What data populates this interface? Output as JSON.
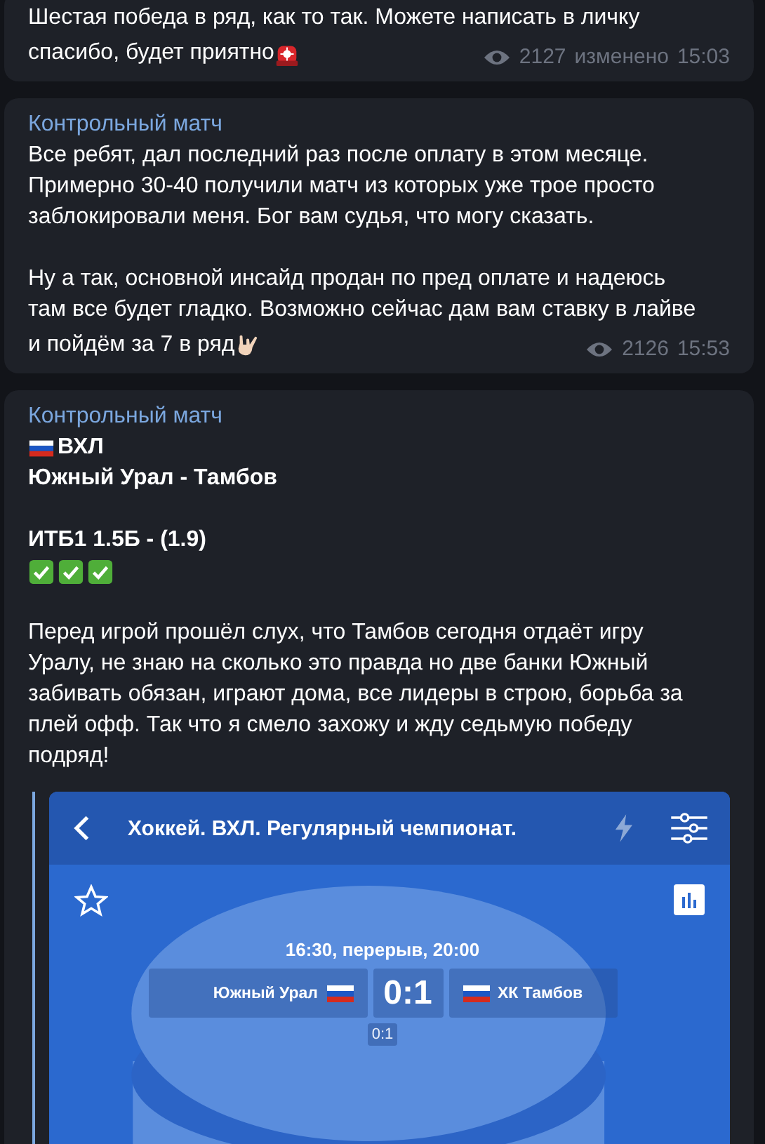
{
  "messages": [
    {
      "blocks": [
        {
          "kind": "text",
          "bold": false,
          "lines": [
            "Шестая победа в ряд, как то так. Можете написать в личку",
            "спасибо, будет приятно"
          ],
          "trail_icon": {
            "kind": "siren"
          }
        }
      ],
      "views": "2127",
      "edited": "изменено",
      "time": "15:03"
    },
    {
      "author": "Контрольный матч",
      "blocks": [
        {
          "kind": "text",
          "bold": false,
          "lines": [
            "Все ребят, дал последний раз после оплату в этом месяце.",
            "Примерно 30-40 получили матч из которых уже трое просто",
            "заблокировали меня. Бог вам судья, что могу сказать."
          ]
        },
        {
          "kind": "text",
          "bold": false,
          "lines": [
            "Ну а так, основной инсайд продан по пред оплате и надеюсь",
            "там все будет гладко. Возможно сейчас дам вам ставку в лайве",
            "и пойдём за 7 в ряд"
          ],
          "trail_icon": {
            "kind": "hand"
          }
        }
      ],
      "views": "2126",
      "time": "15:53"
    },
    {
      "author": "Контрольный матч",
      "blocks": [
        {
          "kind": "text",
          "bold": true,
          "lead_icon": {
            "kind": "flag_ru"
          },
          "lines": [
            "ВХЛ",
            "Южный Урал - Тамбов"
          ]
        },
        {
          "kind": "text",
          "bold": true,
          "lines": [
            "ИТБ1 1.5Б - (1.9)"
          ]
        },
        {
          "kind": "emoji_row",
          "icons": [
            {
              "kind": "check"
            },
            {
              "kind": "check"
            },
            {
              "kind": "check"
            }
          ]
        },
        {
          "kind": "text",
          "bold": false,
          "lines": [
            "Перед игрой прошёл слух, что Тамбов сегодня отдаёт игру",
            "Уралу, не знаю на сколько это правда но две банки Южный",
            "забивать обязан, играют дома, все лидеры в строю, борьба за",
            "плей офф. Так что я смело захожу и жду седьмую победу",
            "подряд!"
          ]
        }
      ],
      "screenshot": {
        "title": "Хоккей. ВХЛ. Регулярный чемпионат.",
        "status": "16:30, перерыв, 20:00",
        "home": "Южный Урал",
        "score": "0:1",
        "away": "ХК Тамбов",
        "period_score": "0:1"
      }
    }
  ]
}
